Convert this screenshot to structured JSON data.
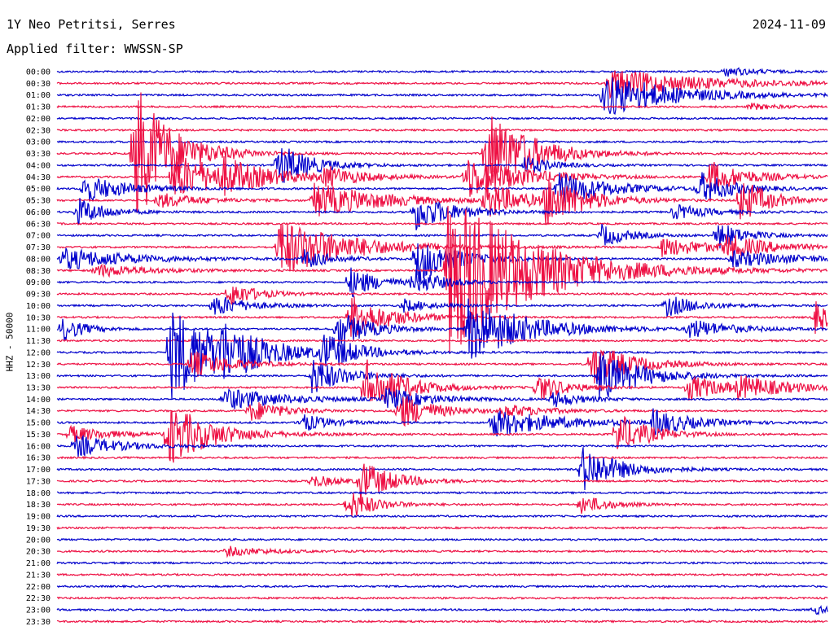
{
  "header": {
    "station": "1Y Neo Petritsi, Serres",
    "date": "2024-11-09",
    "filter": "Applied filter: WWSSN-SP"
  },
  "chart_data": {
    "type": "line",
    "title": "1Y Neo Petritsi, Serres",
    "subtitle": "Applied filter: WWSSN-SP",
    "ylabel": "HHZ - 50000",
    "date": "2024-11-09",
    "row_labels": [
      "00:00",
      "00:30",
      "01:00",
      "01:30",
      "02:00",
      "02:30",
      "03:00",
      "03:30",
      "04:00",
      "04:30",
      "05:00",
      "05:30",
      "06:00",
      "06:30",
      "07:00",
      "07:30",
      "08:00",
      "08:30",
      "09:00",
      "09:30",
      "10:00",
      "10:30",
      "11:00",
      "11:30",
      "12:00",
      "12:30",
      "13:00",
      "13:30",
      "14:00",
      "14:30",
      "15:00",
      "15:30",
      "16:00",
      "16:30",
      "17:00",
      "17:30",
      "18:00",
      "18:30",
      "19:00",
      "19:30",
      "20:00",
      "20:30",
      "21:00",
      "21:30",
      "22:00",
      "22:30",
      "23:00",
      "23:30"
    ],
    "trace_colors": [
      "#0000cc",
      "#ee1144"
    ],
    "events": [
      {
        "time": "00:00",
        "minute": 26.0,
        "amp": 6,
        "dur": 1.2
      },
      {
        "time": "00:30",
        "minute": 21.5,
        "amp": 18,
        "dur": 3.5
      },
      {
        "time": "01:00",
        "minute": 21.3,
        "amp": 28,
        "dur": 2.5
      },
      {
        "time": "01:30",
        "minute": 27.0,
        "amp": 4,
        "dur": 1.0
      },
      {
        "time": "03:30",
        "minute": 3.0,
        "amp": 90,
        "dur": 1.4
      },
      {
        "time": "03:30",
        "minute": 16.7,
        "amp": 60,
        "dur": 1.6
      },
      {
        "time": "04:00",
        "minute": 8.6,
        "amp": 28,
        "dur": 1.2
      },
      {
        "time": "04:00",
        "minute": 18.2,
        "amp": 12,
        "dur": 1.0
      },
      {
        "time": "04:30",
        "minute": 4.5,
        "amp": 28,
        "dur": 2.5
      },
      {
        "time": "04:30",
        "minute": 6.5,
        "amp": 14,
        "dur": 1.2
      },
      {
        "time": "04:30",
        "minute": 10.4,
        "amp": 12,
        "dur": 1.2
      },
      {
        "time": "04:30",
        "minute": 15.9,
        "amp": 28,
        "dur": 2.0
      },
      {
        "time": "04:30",
        "minute": 25.4,
        "amp": 20,
        "dur": 1.4
      },
      {
        "time": "05:00",
        "minute": 1.0,
        "amp": 18,
        "dur": 1.6
      },
      {
        "time": "05:00",
        "minute": 19.5,
        "amp": 22,
        "dur": 1.8
      },
      {
        "time": "05:00",
        "minute": 25.0,
        "amp": 20,
        "dur": 1.2
      },
      {
        "time": "05:30",
        "minute": 3.9,
        "amp": 10,
        "dur": 1.5
      },
      {
        "time": "05:30",
        "minute": 10.0,
        "amp": 22,
        "dur": 2.5
      },
      {
        "time": "05:30",
        "minute": 16.7,
        "amp": 24,
        "dur": 1.2
      },
      {
        "time": "05:30",
        "minute": 19.0,
        "amp": 30,
        "dur": 1.5
      },
      {
        "time": "05:30",
        "minute": 26.6,
        "amp": 30,
        "dur": 1.0
      },
      {
        "time": "06:00",
        "minute": 0.8,
        "amp": 18,
        "dur": 1.0
      },
      {
        "time": "06:00",
        "minute": 13.9,
        "amp": 24,
        "dur": 1.4
      },
      {
        "time": "06:00",
        "minute": 24.0,
        "amp": 10,
        "dur": 1.2
      },
      {
        "time": "07:00",
        "minute": 21.2,
        "amp": 14,
        "dur": 1.0
      },
      {
        "time": "07:00",
        "minute": 25.7,
        "amp": 18,
        "dur": 1.0
      },
      {
        "time": "07:30",
        "minute": 8.6,
        "amp": 38,
        "dur": 2.5
      },
      {
        "time": "07:30",
        "minute": 23.5,
        "amp": 12,
        "dur": 2.0
      },
      {
        "time": "07:30",
        "minute": 26.0,
        "amp": 14,
        "dur": 1.5
      },
      {
        "time": "08:00",
        "minute": 0.2,
        "amp": 14,
        "dur": 2.5
      },
      {
        "time": "08:00",
        "minute": 9.6,
        "amp": 12,
        "dur": 1.0
      },
      {
        "time": "08:00",
        "minute": 14.0,
        "amp": 30,
        "dur": 1.4
      },
      {
        "time": "08:00",
        "minute": 26.3,
        "amp": 10,
        "dur": 2.5
      },
      {
        "time": "08:30",
        "minute": 1.5,
        "amp": 8,
        "dur": 2.0
      },
      {
        "time": "08:30",
        "minute": 15.2,
        "amp": 110,
        "dur": 3.0
      },
      {
        "time": "09:00",
        "minute": 11.4,
        "amp": 20,
        "dur": 1.0
      },
      {
        "time": "09:00",
        "minute": 13.9,
        "amp": 16,
        "dur": 1.0
      },
      {
        "time": "09:30",
        "minute": 6.7,
        "amp": 16,
        "dur": 1.0
      },
      {
        "time": "10:00",
        "minute": 6.1,
        "amp": 14,
        "dur": 1.2
      },
      {
        "time": "10:00",
        "minute": 13.5,
        "amp": 8,
        "dur": 1.0
      },
      {
        "time": "10:00",
        "minute": 23.7,
        "amp": 14,
        "dur": 1.2
      },
      {
        "time": "10:30",
        "minute": 11.4,
        "amp": 28,
        "dur": 1.5
      },
      {
        "time": "10:30",
        "minute": 29.5,
        "amp": 20,
        "dur": 0.8
      },
      {
        "time": "11:00",
        "minute": 0.2,
        "amp": 16,
        "dur": 0.8
      },
      {
        "time": "11:00",
        "minute": 10.9,
        "amp": 24,
        "dur": 1.2
      },
      {
        "time": "11:00",
        "minute": 16.0,
        "amp": 40,
        "dur": 2.2
      },
      {
        "time": "11:00",
        "minute": 24.6,
        "amp": 12,
        "dur": 1.5
      },
      {
        "time": "12:00",
        "minute": 4.4,
        "amp": 60,
        "dur": 2.0
      },
      {
        "time": "12:00",
        "minute": 6.4,
        "amp": 22,
        "dur": 1.4
      },
      {
        "time": "12:00",
        "minute": 10.3,
        "amp": 22,
        "dur": 1.2
      },
      {
        "time": "12:30",
        "minute": 5.2,
        "amp": 18,
        "dur": 1.4
      },
      {
        "time": "12:30",
        "minute": 20.8,
        "amp": 28,
        "dur": 1.5
      },
      {
        "time": "13:00",
        "minute": 9.9,
        "amp": 24,
        "dur": 1.2
      },
      {
        "time": "13:00",
        "minute": 21.1,
        "amp": 32,
        "dur": 1.6
      },
      {
        "time": "13:30",
        "minute": 12.0,
        "amp": 36,
        "dur": 1.4
      },
      {
        "time": "13:30",
        "minute": 18.7,
        "amp": 18,
        "dur": 1.0
      },
      {
        "time": "13:30",
        "minute": 24.6,
        "amp": 16,
        "dur": 1.4
      },
      {
        "time": "13:30",
        "minute": 26.5,
        "amp": 12,
        "dur": 2.0
      },
      {
        "time": "14:00",
        "minute": 6.5,
        "amp": 14,
        "dur": 2.2
      },
      {
        "time": "14:00",
        "minute": 12.8,
        "amp": 14,
        "dur": 1.5
      },
      {
        "time": "14:00",
        "minute": 19.3,
        "amp": 10,
        "dur": 1.0
      },
      {
        "time": "14:30",
        "minute": 7.5,
        "amp": 14,
        "dur": 1.2
      },
      {
        "time": "14:30",
        "minute": 13.3,
        "amp": 24,
        "dur": 1.2
      },
      {
        "time": "14:30",
        "minute": 17.4,
        "amp": 8,
        "dur": 1.5
      },
      {
        "time": "15:00",
        "minute": 9.5,
        "amp": 12,
        "dur": 1.0
      },
      {
        "time": "15:00",
        "minute": 16.9,
        "amp": 18,
        "dur": 2.5
      },
      {
        "time": "15:00",
        "minute": 23.2,
        "amp": 16,
        "dur": 1.4
      },
      {
        "time": "15:30",
        "minute": 0.5,
        "amp": 10,
        "dur": 1.5
      },
      {
        "time": "15:30",
        "minute": 4.3,
        "amp": 40,
        "dur": 1.6
      },
      {
        "time": "15:30",
        "minute": 21.8,
        "amp": 26,
        "dur": 1.2
      },
      {
        "time": "16:00",
        "minute": 0.7,
        "amp": 14,
        "dur": 1.6
      },
      {
        "time": "17:00",
        "minute": 20.4,
        "amp": 30,
        "dur": 1.4
      },
      {
        "time": "17:30",
        "minute": 11.8,
        "amp": 26,
        "dur": 1.2
      },
      {
        "time": "17:30",
        "minute": 9.9,
        "amp": 8,
        "dur": 1.0
      },
      {
        "time": "18:30",
        "minute": 11.3,
        "amp": 20,
        "dur": 1.0
      },
      {
        "time": "18:30",
        "minute": 20.4,
        "amp": 12,
        "dur": 1.0
      },
      {
        "time": "20:30",
        "minute": 6.6,
        "amp": 6,
        "dur": 1.5
      },
      {
        "time": "23:00",
        "minute": 29.5,
        "amp": 5,
        "dur": 1.0
      }
    ]
  }
}
